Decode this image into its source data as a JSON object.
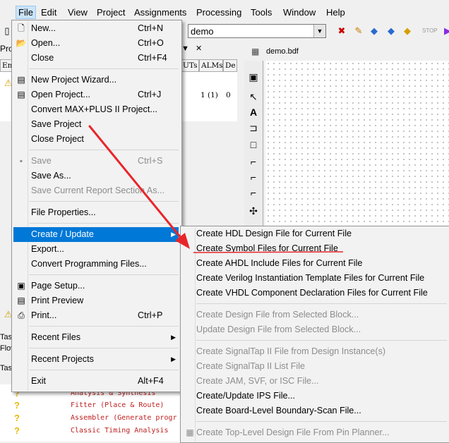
{
  "menubar": {
    "items": [
      "File",
      "Edit",
      "View",
      "Project",
      "Assignments",
      "Processing",
      "Tools",
      "Window",
      "Help"
    ]
  },
  "toolbar": {
    "project_combo": "demo"
  },
  "panels": {
    "project_label": "Pro",
    "entity_header": "En",
    "luts_header": "UTs",
    "alms_header": "ALMs",
    "d_header": "De",
    "alms_value": "1 (1)",
    "d_value": "0",
    "tasks_label": "Tas",
    "flow_label": "Flow",
    "task_label2": "Tas",
    "file_tab": "demo.bdf",
    "tasks": [
      "Analysis & Synthesis",
      "Fitter (Place & Route)",
      "Assembler (Generate progr",
      "Classic Timing Analysis"
    ]
  },
  "file_menu": [
    {
      "label": "New...",
      "shortcut": "Ctrl+N",
      "icon": "new-file-icon"
    },
    {
      "label": "Open...",
      "shortcut": "Ctrl+O",
      "icon": "open-folder-icon"
    },
    {
      "label": "Close",
      "shortcut": "Ctrl+F4"
    },
    {
      "sep": true
    },
    {
      "label": "New Project Wizard...",
      "icon": "project-wizard-icon"
    },
    {
      "label": "Open Project...",
      "shortcut": "Ctrl+J",
      "icon": "open-project-icon"
    },
    {
      "label": "Convert MAX+PLUS II Project..."
    },
    {
      "label": "Save Project"
    },
    {
      "label": "Close Project"
    },
    {
      "sep": true
    },
    {
      "label": "Save",
      "shortcut": "Ctrl+S",
      "disabled": true,
      "icon": "save-icon"
    },
    {
      "label": "Save As..."
    },
    {
      "label": "Save Current Report Section As...",
      "disabled": true
    },
    {
      "sep": true
    },
    {
      "label": "File Properties..."
    },
    {
      "sep": true
    },
    {
      "label": "Create / Update",
      "submenu": true,
      "highlighted": true
    },
    {
      "label": "Export..."
    },
    {
      "label": "Convert Programming Files..."
    },
    {
      "sep": true
    },
    {
      "label": "Page Setup...",
      "icon": "page-setup-icon"
    },
    {
      "label": "Print Preview",
      "icon": "print-preview-icon"
    },
    {
      "label": "Print...",
      "shortcut": "Ctrl+P",
      "icon": "printer-icon"
    },
    {
      "sep": true
    },
    {
      "label": "Recent Files",
      "submenu": true
    },
    {
      "sep": true
    },
    {
      "label": "Recent Projects",
      "submenu": true
    },
    {
      "sep": true
    },
    {
      "label": "Exit",
      "shortcut": "Alt+F4"
    }
  ],
  "create_update_menu": [
    {
      "label": "Create HDL Design File for Current File"
    },
    {
      "label": "Create Symbol Files for Current File",
      "annotated": true
    },
    {
      "label": "Create AHDL Include Files for Current File"
    },
    {
      "label": "Create Verilog Instantiation Template Files for Current File"
    },
    {
      "label": "Create VHDL Component Declaration Files for Current File"
    },
    {
      "sep": true
    },
    {
      "label": "Create Design File from Selected Block...",
      "disabled": true
    },
    {
      "label": "Update Design File from Selected Block...",
      "disabled": true
    },
    {
      "sep": true
    },
    {
      "label": "Create SignalTap II File from Design Instance(s)",
      "disabled": true
    },
    {
      "label": "Create SignalTap II List File",
      "disabled": true
    },
    {
      "label": "Create JAM, SVF, or ISC File...",
      "disabled": true
    },
    {
      "label": "Create/Update IPS File..."
    },
    {
      "label": "Create Board-Level Boundary-Scan File..."
    },
    {
      "sep": true
    },
    {
      "label": "Create Top-Level Design File From Pin Planner...",
      "disabled": true,
      "icon": "pin-planner-icon"
    }
  ],
  "annotation": {
    "arrow_color": "#e8262a",
    "underline_color": "#e8262a"
  },
  "colors": {
    "highlight": "#0078d7",
    "disabled": "#8d8d8d"
  }
}
